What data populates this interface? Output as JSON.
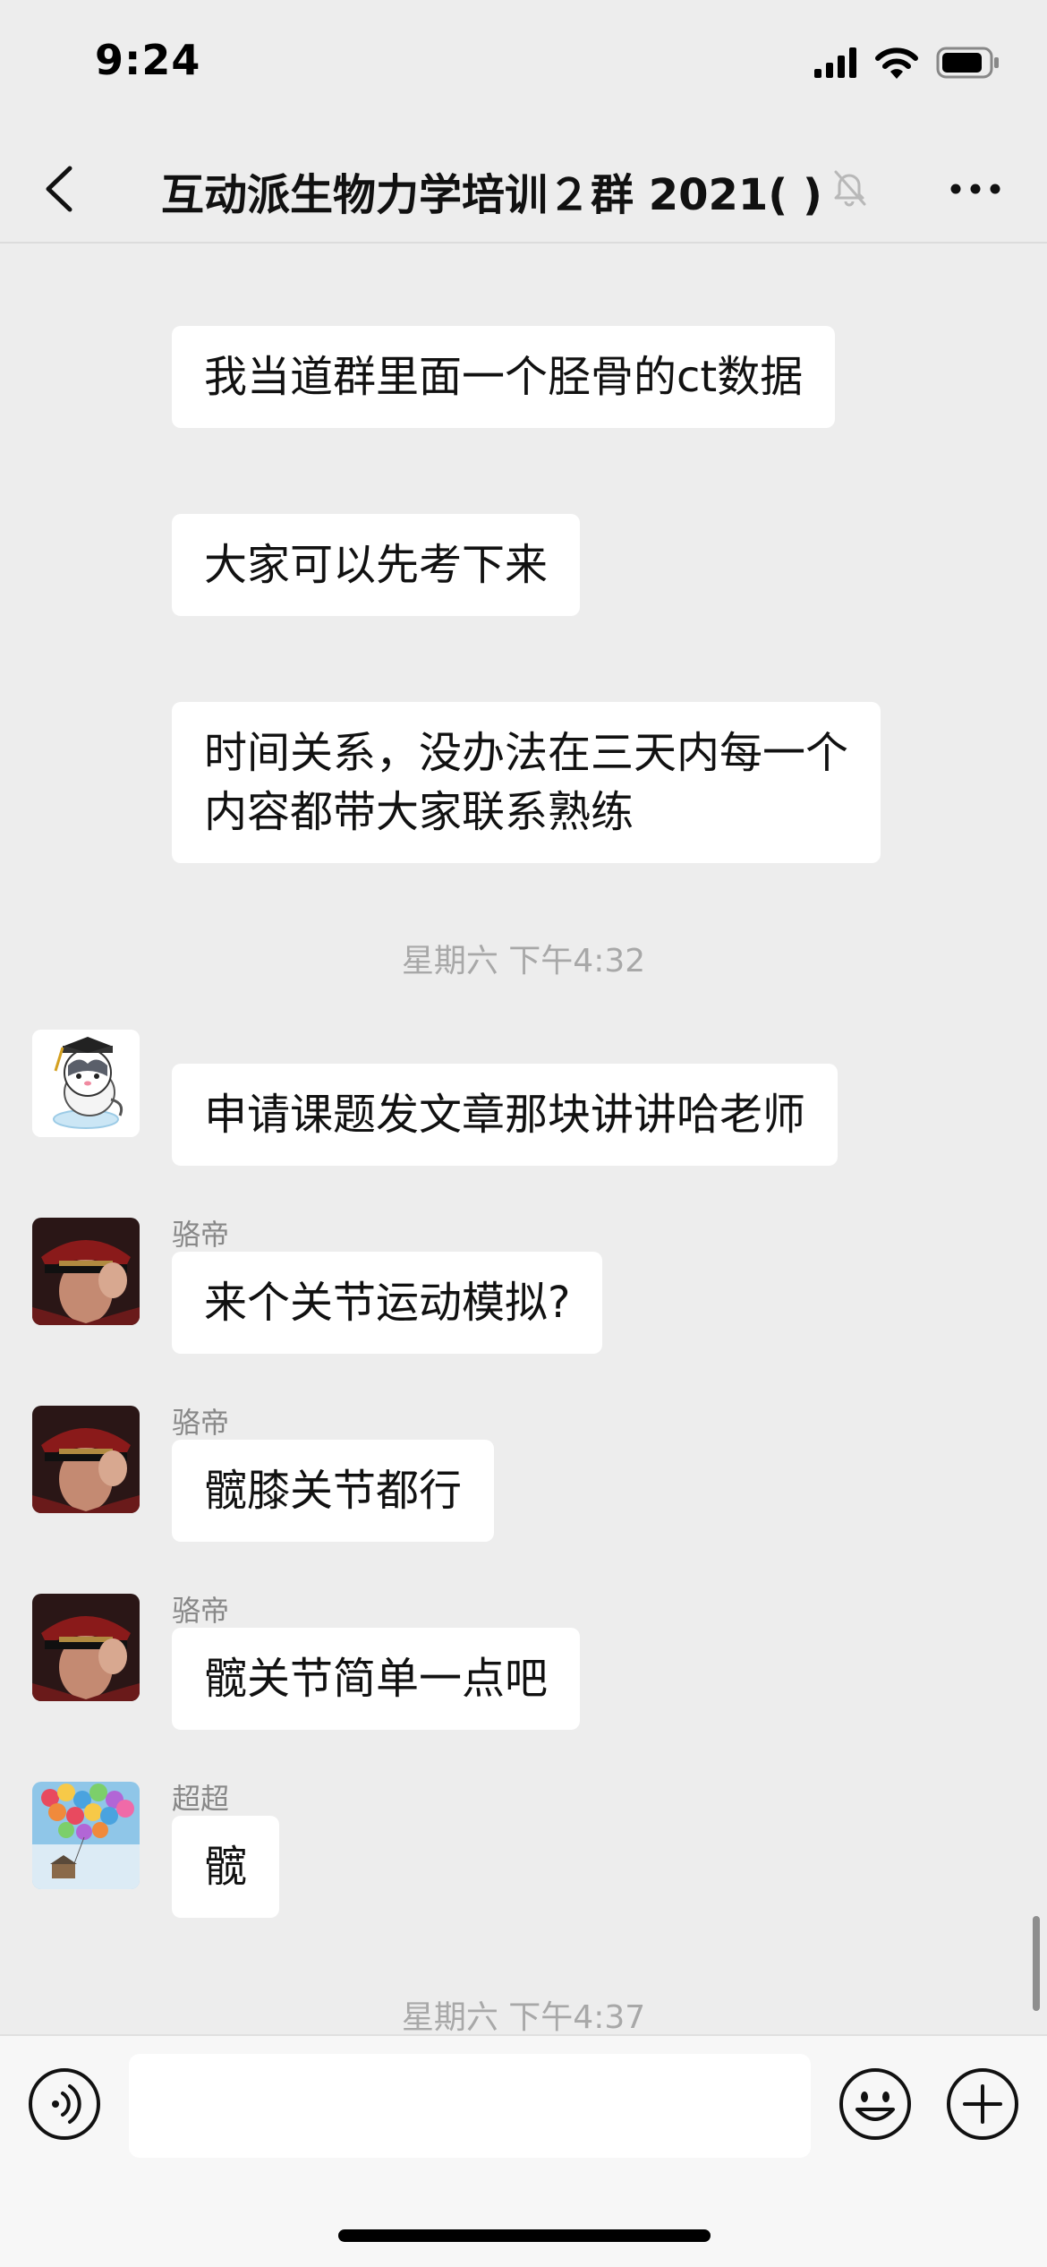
{
  "status_bar": {
    "time": "9:24"
  },
  "nav": {
    "title": "互动派生物力学培训２群 2021(   )"
  },
  "messages": [
    {
      "type": "bubble",
      "sender": "",
      "text": "我当道群里面一个胫骨的ct数据"
    },
    {
      "type": "bubble",
      "sender": "",
      "text": "大家可以先考下来"
    },
    {
      "type": "bubble",
      "sender": "",
      "text_lines": [
        "时间关系，没办法在三天内每一个",
        "内容都带大家联系熟练"
      ]
    },
    {
      "type": "time",
      "text": "星期六 下午4:32"
    },
    {
      "type": "bubble",
      "sender": "",
      "avatar": "cat-avatar",
      "text": "申请课题发文章那块讲讲哈老师"
    },
    {
      "type": "bubble",
      "sender": "骆帝",
      "avatar": "cap-man-avatar",
      "text": "来个关节运动模拟?"
    },
    {
      "type": "bubble",
      "sender": "骆帝",
      "avatar": "cap-man-avatar",
      "text": "髋膝关节都行"
    },
    {
      "type": "bubble",
      "sender": "骆帝",
      "avatar": "cap-man-avatar",
      "text": "髋关节简单一点吧"
    },
    {
      "type": "bubble",
      "sender": "超超",
      "avatar": "balloon-house-avatar",
      "text": "髋"
    },
    {
      "type": "time",
      "text": "星期六 下午4:37"
    }
  ],
  "colors": {
    "background": "#ededed",
    "bubble": "#ffffff",
    "meta_text": "#a8a8a8",
    "sender_text": "#888888"
  },
  "icons": {
    "status": [
      "cellular-signal-icon",
      "wifi-icon",
      "battery-icon"
    ],
    "nav": [
      "back-chevron-icon",
      "mute-bell-icon",
      "more-dots-icon"
    ],
    "input": [
      "voice-icon",
      "emoji-icon",
      "plus-icon"
    ]
  }
}
